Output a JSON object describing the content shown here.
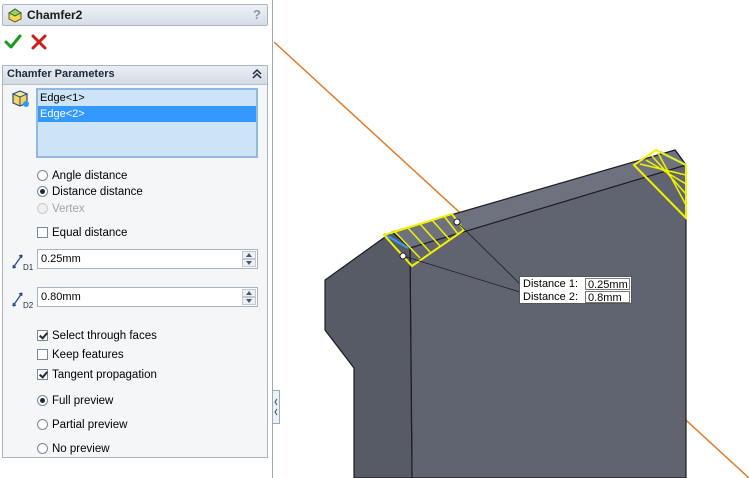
{
  "panel": {
    "title": "Chamfer2",
    "help": "?"
  },
  "group": {
    "title": "Chamfer Parameters"
  },
  "edges": [
    "Edge<1>",
    "Edge<2>"
  ],
  "chamfer_type": {
    "angle_distance": "Angle distance",
    "distance_distance": "Distance distance",
    "vertex": "Vertex",
    "selected": "distance_distance"
  },
  "equal_distance": {
    "label": "Equal distance",
    "checked": false
  },
  "d1": {
    "value": "0.25mm",
    "label": "D1"
  },
  "d2": {
    "value": "0.80mm",
    "label": "D2"
  },
  "options": {
    "select_through_faces": {
      "label": "Select through faces",
      "checked": true
    },
    "keep_features": {
      "label": "Keep features",
      "checked": false
    },
    "tangent_propagation": {
      "label": "Tangent propagation",
      "checked": true
    }
  },
  "preview": {
    "full": "Full preview",
    "partial": "Partial preview",
    "none": "No preview",
    "selected": "full"
  },
  "callout": {
    "distance1_label": "Distance 1:",
    "distance1_value": "0.25mm",
    "distance2_label": "Distance 2:",
    "distance2_value": "0.8mm"
  },
  "colors": {
    "model_face": "#5f6470",
    "model_edge": "#1c1c22",
    "highlight": "#f2f200",
    "plane_line": "#e07a2a",
    "selection": "#3399ff"
  }
}
